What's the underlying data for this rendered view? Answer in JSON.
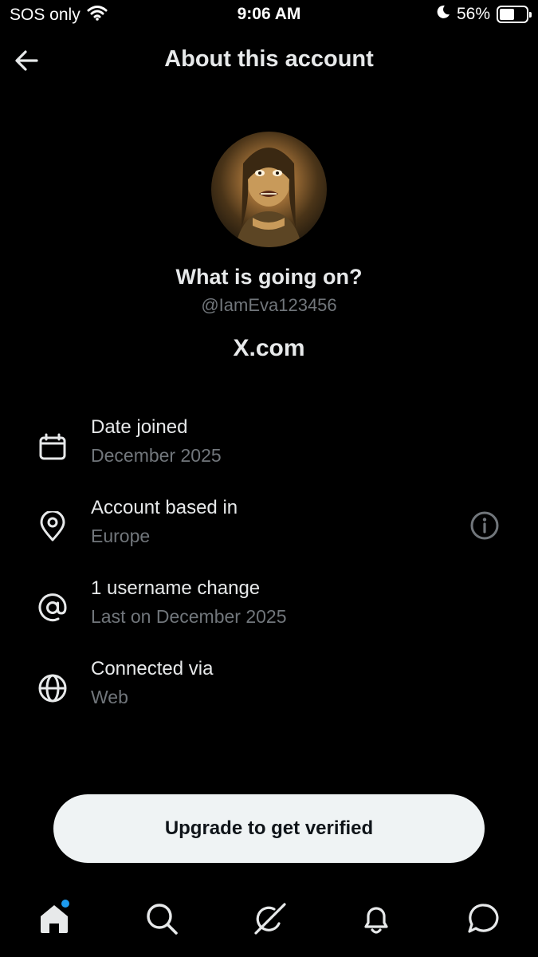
{
  "status_bar": {
    "carrier": "SOS only",
    "time": "9:06 AM",
    "battery_text": "56%",
    "battery_level": 0.56
  },
  "header": {
    "title": "About this account",
    "back_icon": "arrow-left-icon"
  },
  "profile": {
    "display_name": "What is going on?",
    "handle": "@IamEva123456",
    "source": "X.com"
  },
  "info_rows": [
    {
      "icon": "calendar-icon",
      "title": "Date joined",
      "subtitle": "December 2025"
    },
    {
      "icon": "location-pin-icon",
      "title": "Account based in",
      "subtitle": "Europe",
      "action_icon": "info-icon"
    },
    {
      "icon": "at-sign-icon",
      "title": "1 username change",
      "subtitle": "Last on December 2025"
    },
    {
      "icon": "globe-icon",
      "title": "Connected via",
      "subtitle": "Web"
    }
  ],
  "upgrade_button": {
    "label": "Upgrade to get verified"
  },
  "bottom_nav": {
    "items": [
      "home-icon",
      "search-icon",
      "grok-icon",
      "notifications-bell-icon",
      "messages-icon"
    ],
    "home_badge_color": "#1d9bf0"
  },
  "colors": {
    "background": "#000000",
    "primary_text": "#e7e9ea",
    "secondary_text": "#71767b",
    "button_bg": "#eff3f4",
    "accent": "#1d9bf0"
  }
}
